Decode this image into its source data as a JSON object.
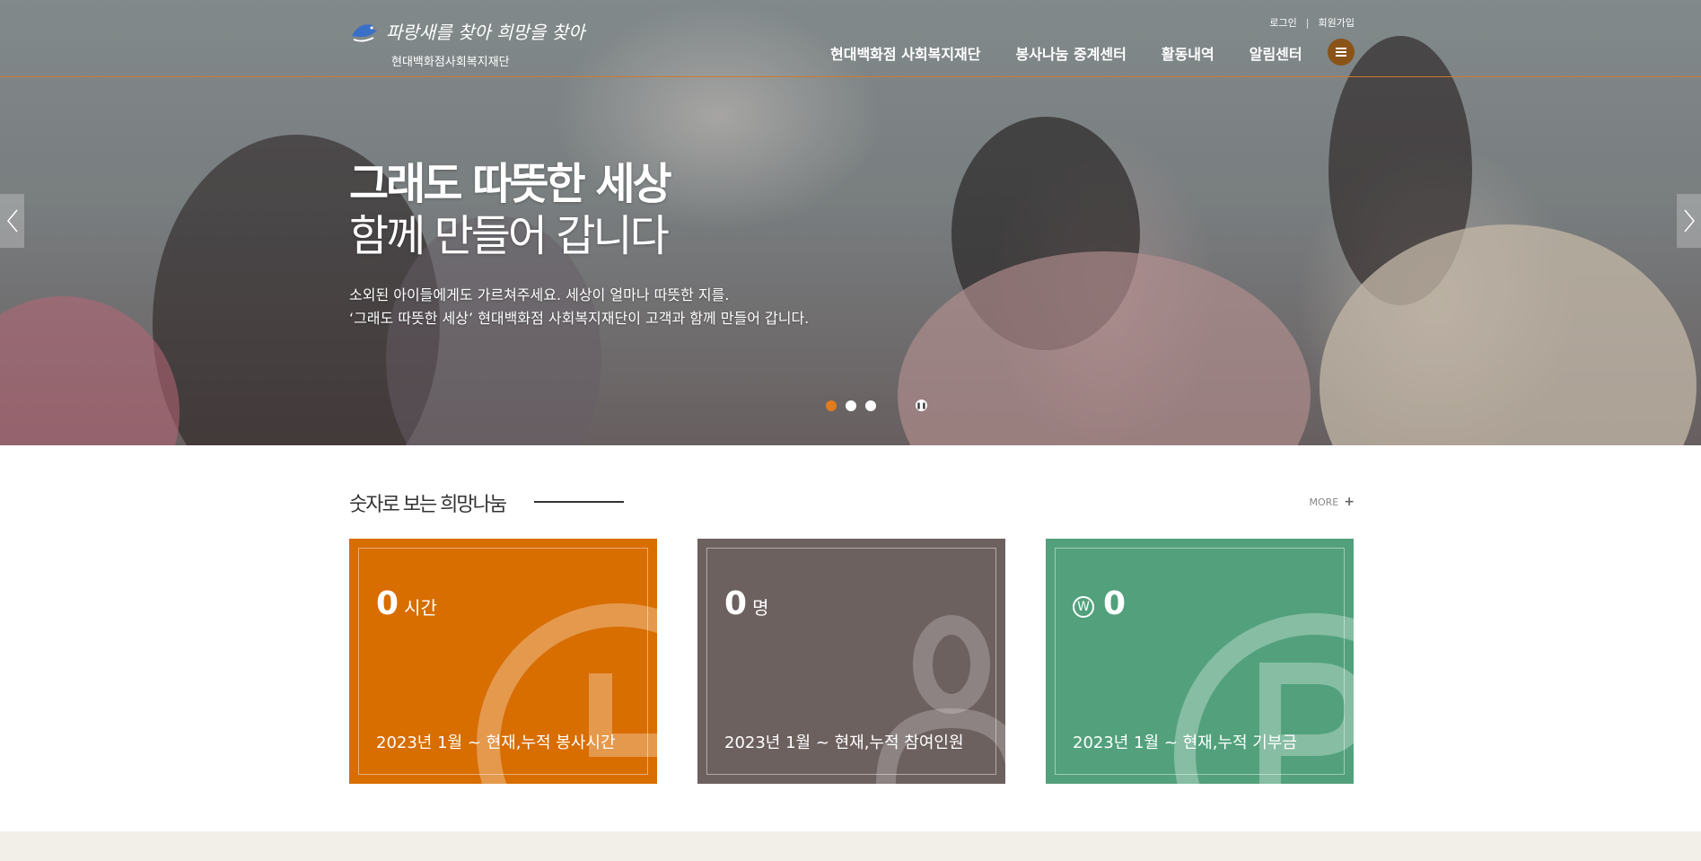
{
  "header": {
    "logo": {
      "script_text": "파랑새를 찾아 희망을 찾아",
      "sub_text": "현대백화점사회복지재단"
    },
    "util": {
      "login": "로그인",
      "separator": "|",
      "signup": "회원가입"
    },
    "gnb": [
      "현대백화점 사회복지재단",
      "봉사나눔 중계센터",
      "활동내역",
      "알림센터"
    ],
    "menu_icon": "hamburger-icon"
  },
  "hero": {
    "title_line1": "그래도 따뜻한 세상",
    "title_line2": "함께 만들어 갑니다",
    "desc_line1": "소외된 아이들에게도 가르쳐주세요. 세상이 얼마나 따뜻한 지를.",
    "desc_line2": "‘그래도 따뜻한 세상’ 현대백화점 사회복지재단이 고객과 함께 만들어 갑니다.",
    "slides": 3,
    "active_slide": 1,
    "prev_icon": "chevron-left-icon",
    "next_icon": "chevron-right-icon",
    "pause_icon": "pause-icon"
  },
  "stats_section": {
    "title": "숫자로 보는 희망나눔",
    "more_label": "MORE",
    "more_icon": "plus-icon",
    "cards": [
      {
        "value": "0",
        "unit": "시간",
        "period": "2023년 1월 ~ 현재,누적 봉사시간",
        "color": "#d86d00",
        "icon": "clock-icon"
      },
      {
        "value": "0",
        "unit": "명",
        "period": "2023년 1월 ~ 현재,누적 참여인원",
        "color": "#6d6160",
        "icon": "person-icon"
      },
      {
        "value": "0",
        "currency": "W",
        "period": "2023년 1월 ~ 현재,누적 기부금",
        "color": "#52a17c",
        "icon": "coin-icon"
      }
    ]
  },
  "colors": {
    "accent": "#e07b1e",
    "header_line": "#d07a2a",
    "footer_band": "#f2efe8"
  }
}
